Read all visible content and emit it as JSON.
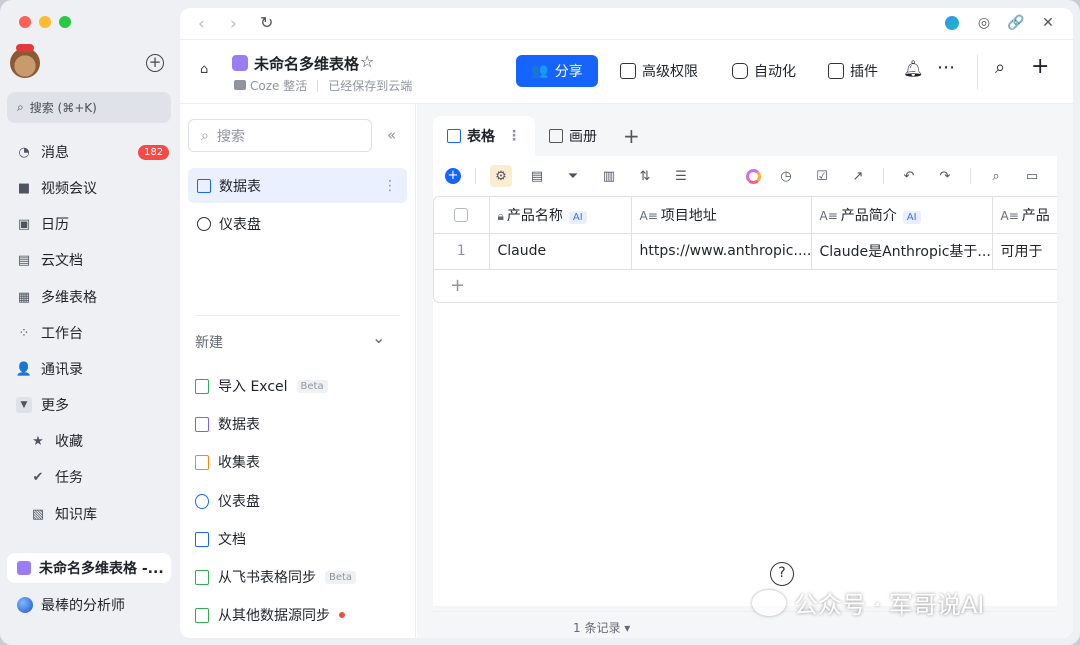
{
  "sidebar": {
    "search_label": "搜索 (⌘+K)",
    "messages_badge": "182",
    "items": [
      {
        "label": "消息",
        "icon": "chat-icon"
      },
      {
        "label": "视频会议",
        "icon": "video-icon"
      },
      {
        "label": "日历",
        "icon": "calendar-icon"
      },
      {
        "label": "云文档",
        "icon": "doc-icon"
      },
      {
        "label": "多维表格",
        "icon": "base-icon"
      },
      {
        "label": "工作台",
        "icon": "apps-icon"
      },
      {
        "label": "通讯录",
        "icon": "contacts-icon"
      },
      {
        "label": "更多",
        "icon": "caret-down-icon"
      }
    ],
    "sub_items": [
      {
        "label": "收藏",
        "icon": "star-icon"
      },
      {
        "label": "任务",
        "icon": "check-icon"
      },
      {
        "label": "知识库",
        "icon": "wiki-icon"
      }
    ],
    "recent": [
      {
        "label": "未命名多维表格 -..."
      },
      {
        "label": "最棒的分析师"
      }
    ]
  },
  "header": {
    "title": "未命名多维表格",
    "workspace": "Coze 整活",
    "save_status": "已经保存到云端",
    "share_label": "分享",
    "permissions_label": "高级权限",
    "automation_label": "自动化",
    "plugins_label": "插件"
  },
  "data_sidebar": {
    "search_placeholder": "搜索",
    "items": [
      {
        "label": "数据表"
      },
      {
        "label": "仪表盘"
      }
    ],
    "new_label": "新建",
    "new_items": [
      {
        "label": "导入 Excel",
        "beta": "Beta",
        "color": "#34a853"
      },
      {
        "label": "数据表",
        "color": "#7b61ff"
      },
      {
        "label": "收集表",
        "color": "#ff8800"
      },
      {
        "label": "仪表盘",
        "color": "#1664ff"
      },
      {
        "label": "文档",
        "color": "#1664ff"
      },
      {
        "label": "从飞书表格同步",
        "beta": "Beta",
        "color": "#34a853"
      },
      {
        "label": "从其他数据源同步",
        "color": "#34a853"
      }
    ]
  },
  "view": {
    "tabs": [
      {
        "label": "表格"
      },
      {
        "label": "画册"
      }
    ],
    "columns": [
      {
        "label": "产品名称",
        "ai": "AI"
      },
      {
        "label": "项目地址"
      },
      {
        "label": "产品简介",
        "ai": "AI"
      },
      {
        "label": "产品"
      }
    ],
    "rows": [
      {
        "index": "1",
        "cells": [
          "Claude",
          "https://www.anthropic....",
          "Claude是Anthropic基于...",
          "可用于"
        ]
      }
    ],
    "record_count": "1 条记录"
  },
  "watermark": "公众号 · 军哥说AI",
  "colors": {
    "accent": "#1664ff",
    "badge": "#f54a45",
    "base_icon": "#9b7cf2"
  }
}
